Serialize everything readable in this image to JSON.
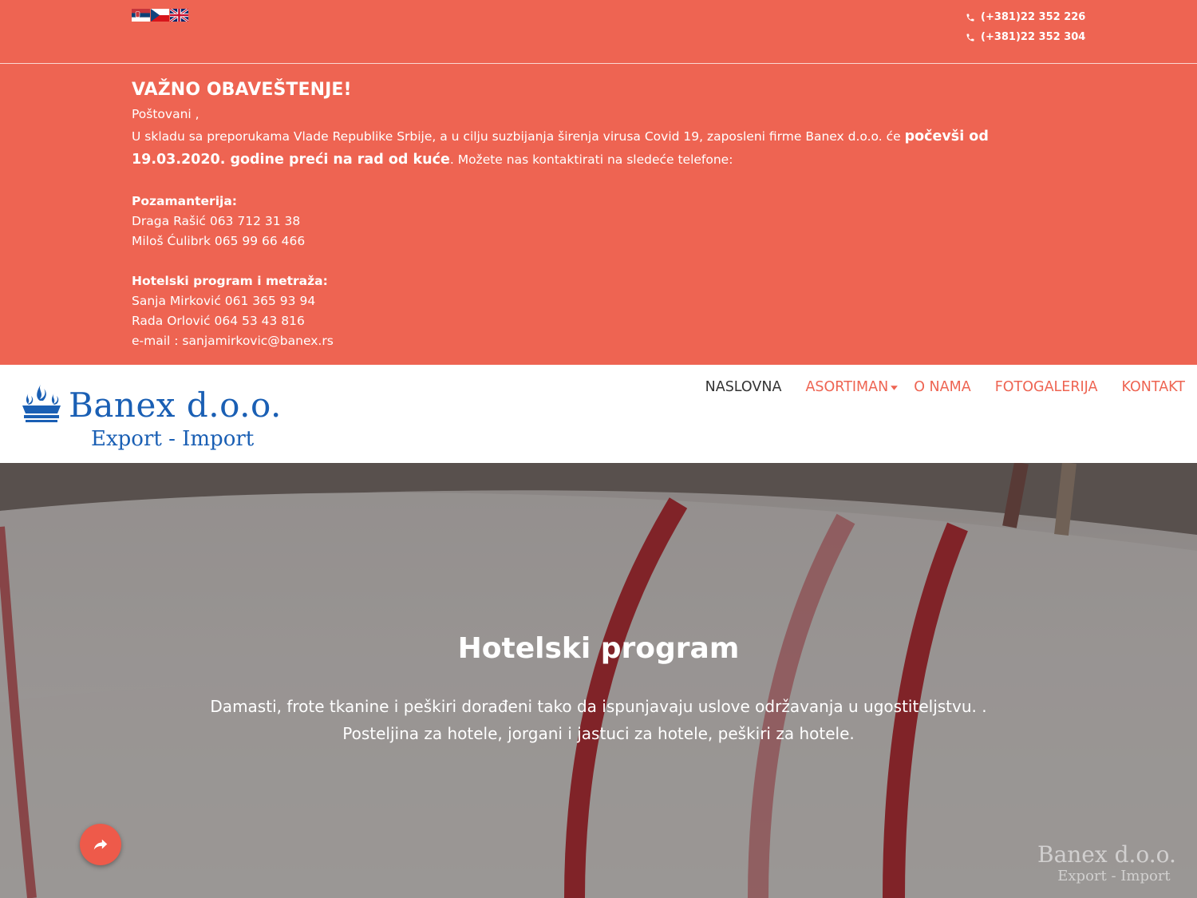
{
  "colors": {
    "accent": "#ee6452",
    "brand_blue": "#1a5fb4",
    "nav_active": "#333333"
  },
  "topbar": {
    "flags": [
      {
        "name": "serbian-flag-icon"
      },
      {
        "name": "czech-flag-icon"
      },
      {
        "name": "uk-flag-icon"
      }
    ],
    "phones": [
      "(+381)22 352 226",
      "(+381)22 352 304"
    ]
  },
  "notice": {
    "title": "VAŽNO OBAVEŠTENJE!",
    "greeting": "Poštovani ,",
    "text_1": "U skladu sa preporukama Vlade Republike Srbije, a u cilju suzbijanja širenja virusa Covid 19, zaposleni firme Banex d.o.o. će ",
    "text_bold": "počevši od 19.03.2020. godine preći na rad od kuće",
    "text_2": ". Možete nas kontaktirati na sledeće telefone:",
    "section_1_label": "Pozamanterija:",
    "section_1_lines": [
      "Draga Rašić 063 712 31 38",
      "Miloš Ćulibrk 065 99 66 466"
    ],
    "section_2_label": "Hotelski program i metraža:",
    "section_2_lines": [
      "Sanja Mirković 061 365 93 94",
      "Rada Orlović 064 53 43 816",
      "e-mail : sanjamirkovic@banex.rs"
    ]
  },
  "header": {
    "logo_name": "Banex d.o.o.",
    "logo_sub": "Export - Import",
    "nav": [
      {
        "label": "NASLOVNA",
        "active": true
      },
      {
        "label": "ASORTIMAN",
        "dropdown": true
      },
      {
        "label": "O NAMA"
      },
      {
        "label": "FOTOGALERIJA"
      },
      {
        "label": "KONTAKT"
      }
    ]
  },
  "hero": {
    "title": "Hotelski program",
    "line_1": "Damasti, frote tkanine i peškiri dorađeni tako da ispunjavaju uslove održavanja u ugostiteljstvu. .",
    "line_2": "Posteljina za hotele, jorgani i jastuci za hotele, peškiri za hotele.",
    "watermark_1": "Banex d.o.o.",
    "watermark_2": "Export - Import"
  },
  "share_icon": "share-icon"
}
